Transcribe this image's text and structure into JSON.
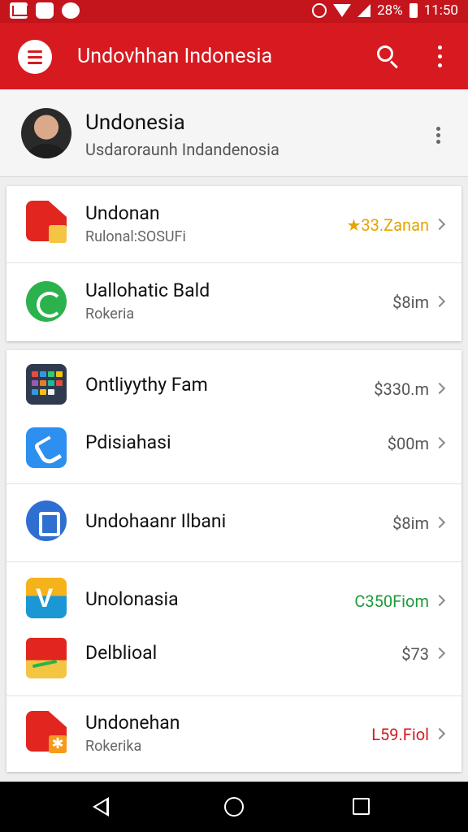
{
  "status_bar": {
    "battery": "28%",
    "time": "11:50"
  },
  "app_bar": {
    "title": "Undovhhan Indonesia"
  },
  "profile": {
    "name": "Undonesia",
    "subtitle": "Usdaroraunh Indandenosia"
  },
  "items": [
    {
      "title": "Undonan",
      "subtitle": "Rulonal:SOSUFi",
      "price": "★33.Zanan",
      "price_color": "#e6a400"
    },
    {
      "title": "Uallohatic Bald",
      "subtitle": "Rokeria",
      "price": "$8im",
      "price_color": "#555555"
    },
    {
      "title": "Ontliyythy Fam",
      "subtitle": "",
      "price": "$330.m",
      "price_color": "#555555"
    },
    {
      "title": "Pdisiahasi",
      "subtitle": "",
      "price": "$00m",
      "price_color": "#555555"
    },
    {
      "title": "Undohaanr Ilbani",
      "subtitle": "",
      "price": "$8im",
      "price_color": "#555555"
    },
    {
      "title": "Unolonasia",
      "subtitle": "",
      "price": "C350Fiom",
      "price_color": "#1e9a3c"
    },
    {
      "title": "Delblioal",
      "subtitle": "",
      "price": "$73",
      "price_color": "#555555"
    },
    {
      "title": "Undonehan",
      "subtitle": "Rokerika",
      "price": "L59.Fiol",
      "price_color": "#d71920"
    }
  ],
  "colors": {
    "primary": "#d71920",
    "status_bar": "#c4151c"
  }
}
